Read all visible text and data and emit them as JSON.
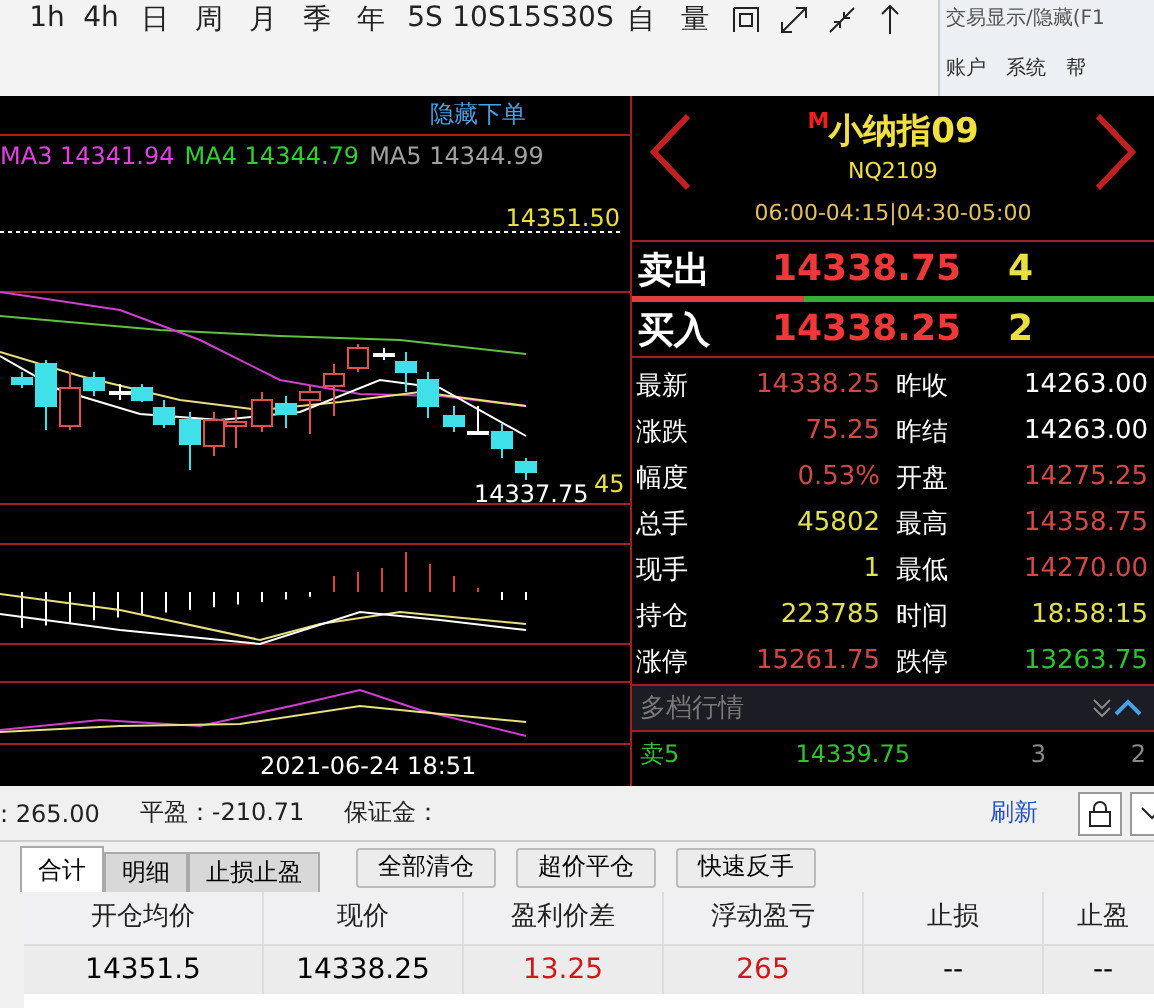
{
  "toolbar": {
    "periods": [
      {
        "label": "1h",
        "selected": false
      },
      {
        "label": "4h",
        "selected": false
      },
      {
        "label": "日",
        "selected": false
      },
      {
        "label": "周",
        "selected": false
      },
      {
        "label": "月",
        "selected": false
      },
      {
        "label": "季",
        "selected": false
      },
      {
        "label": "年",
        "selected": false
      },
      {
        "label": "5S",
        "selected": false
      },
      {
        "label": "10S",
        "selected": false
      },
      {
        "label": "15S",
        "selected": false
      },
      {
        "label": "30S",
        "selected": false
      },
      {
        "label": "自",
        "selected": false
      },
      {
        "label": "量",
        "selected": false
      }
    ]
  },
  "side_menu": {
    "title": "交易显示/隐藏(F1",
    "items": [
      "账户",
      "系统",
      "帮"
    ]
  },
  "chart": {
    "hide_order_link": "隐藏下单",
    "legend": [
      {
        "label": "MA3 14341.94",
        "color": "#e040e0"
      },
      {
        "label": "MA4 14344.79",
        "color": "#30d030"
      },
      {
        "label": "MA5 14344.99",
        "color": "#a0a0a0"
      }
    ],
    "high_label": "14351.50",
    "low_label": "14337.75",
    "side_label": "45",
    "date_label": "2021-06-24 18:51"
  },
  "quote": {
    "marker": "M",
    "name": "小纳指09",
    "code": "NQ2109",
    "session": "06:00-04:15|04:30-05:00",
    "sell": {
      "label": "卖出",
      "price": "14338.75",
      "volume": "4"
    },
    "ratio_bar": {
      "level": 0.33
    },
    "buy": {
      "label": "买入",
      "price": "14338.25",
      "volume": "2"
    },
    "stats": [
      {
        "label": "最新",
        "value": "14338.25",
        "color": "#d04848"
      },
      {
        "label": "昨收",
        "value": "14263.00",
        "color": "#ffffff"
      },
      {
        "label": "涨跌",
        "value": "75.25",
        "color": "#d04848"
      },
      {
        "label": "昨结",
        "value": "14263.00",
        "color": "#ffffff"
      },
      {
        "label": "幅度",
        "value": "0.53%",
        "color": "#d04848"
      },
      {
        "label": "开盘",
        "value": "14275.25",
        "color": "#d04848"
      },
      {
        "label": "总手",
        "value": "45802",
        "color": "#e0e050"
      },
      {
        "label": "最高",
        "value": "14358.75",
        "color": "#d04848"
      },
      {
        "label": "现手",
        "value": "1",
        "color": "#e0e050"
      },
      {
        "label": "最低",
        "value": "14270.00",
        "color": "#d04848"
      },
      {
        "label": "持仓",
        "value": "223785",
        "color": "#e0e050"
      },
      {
        "label": "时间",
        "value": "18:58:15",
        "color": "#e0e050"
      },
      {
        "label": "涨停",
        "value": "15261.75",
        "color": "#d04848"
      },
      {
        "label": "跌停",
        "value": "13263.75",
        "color": "#30c030"
      }
    ],
    "depth_title": "多档行情",
    "depth_expanded": true,
    "depth_rows": [
      {
        "label": "卖5",
        "price": "14339.75",
        "volume": "3",
        "column_4": "2"
      }
    ]
  },
  "account": {
    "fragment": ": 265.00",
    "close_pl": "平盈：-210.71",
    "margin": "保证金：",
    "refresh": "刷新"
  },
  "tabs": [
    {
      "label": "合计",
      "selected": true
    },
    {
      "label": "明细",
      "selected": false
    },
    {
      "label": "止损止盈",
      "selected": false
    }
  ],
  "actions": [
    "全部清仓",
    "超价平仓",
    "快速反手"
  ],
  "table": {
    "columns": [
      "开仓均价",
      "现价",
      "盈利价差",
      "浮动盈亏",
      "止损",
      "止盈"
    ],
    "rows": [
      [
        {
          "text": "14351.5",
          "color": "#000000"
        },
        {
          "text": "14338.25",
          "color": "#000000"
        },
        {
          "text": "13.25",
          "color": "#d01818"
        },
        {
          "text": "265",
          "color": "#d01818"
        },
        {
          "text": "--",
          "color": "#000000"
        },
        {
          "text": "--",
          "color": "#000000"
        }
      ]
    ]
  }
}
